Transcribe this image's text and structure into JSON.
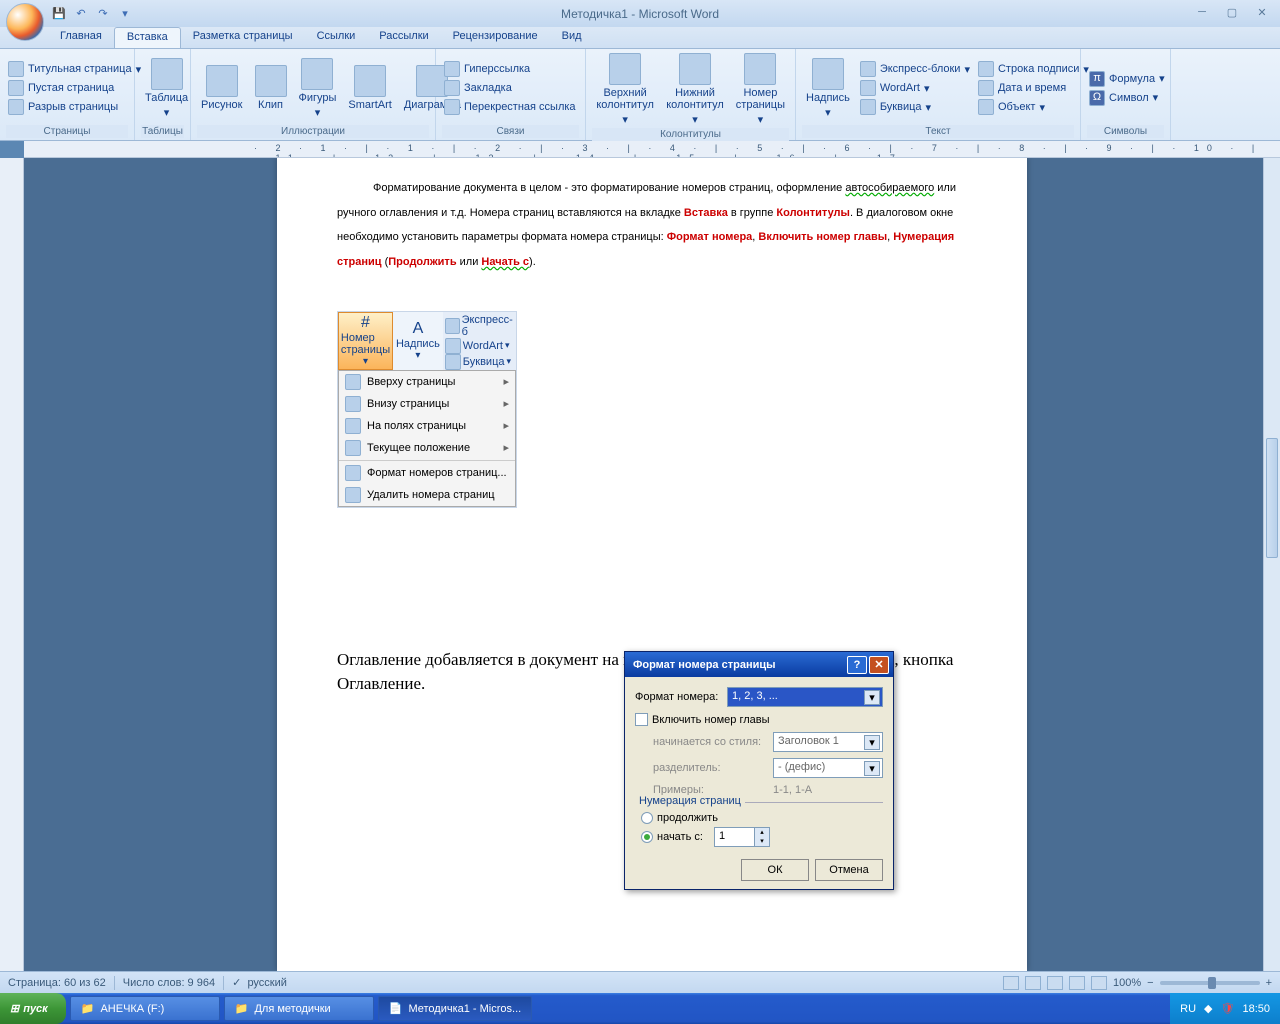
{
  "window": {
    "title": "Методичка1 - Microsoft Word"
  },
  "tabs": [
    "Главная",
    "Вставка",
    "Разметка страницы",
    "Ссылки",
    "Рассылки",
    "Рецензирование",
    "Вид"
  ],
  "ribbon": {
    "pages": {
      "title": "Страницы",
      "items": [
        "Титульная страница",
        "Пустая страница",
        "Разрыв страницы"
      ]
    },
    "tables": {
      "title": "Таблицы",
      "btn": "Таблица"
    },
    "illus": {
      "title": "Иллюстрации",
      "items": [
        "Рисунок",
        "Клип",
        "Фигуры",
        "SmartArt",
        "Диаграмма"
      ]
    },
    "links": {
      "title": "Связи",
      "items": [
        "Гиперссылка",
        "Закладка",
        "Перекрестная ссылка"
      ]
    },
    "headers": {
      "title": "Колонтитулы",
      "items": [
        "Верхний колонтитул",
        "Нижний колонтитул",
        "Номер страницы"
      ]
    },
    "text": {
      "title": "Текст",
      "big": "Надпись",
      "items": [
        "Экспресс-блоки",
        "WordArt",
        "Буквица",
        "Строка подписи",
        "Дата и время",
        "Объект"
      ]
    },
    "symbols": {
      "title": "Символы",
      "items": [
        "Формула",
        "Символ"
      ]
    }
  },
  "document": {
    "p1_pre": "Форматирование документа в целом - это форматирование номеров страниц, оформление ",
    "p1_auto": "автособираемого",
    "p1_mid": " или ручного оглавления и т.д. Номера страниц вставляются на вкладке ",
    "p1_vst": "Вставка",
    "p1_mid2": " в группе ",
    "p1_kol": "Колонтитулы",
    "p1_mid3": ". В диалоговом окне необходимо установить параметры формата номера страницы: ",
    "p1_fn": "Формат номера",
    "p1_c1": ", ",
    "p1_inc": "Включить номер главы",
    "p1_c2": ", ",
    "p1_num": "Нумерация страниц",
    "p1_open": " (",
    "p1_cont": "Продолжить",
    "p1_or": " или ",
    "p1_start": "Начать с",
    "p1_close": ").",
    "toc": "Оглавление добавляется в документ на вкладке Ссылки в группе Оглавление, кнопка Оглавление."
  },
  "embedded": {
    "page_num": "Номер страницы",
    "caption": "Надпись",
    "express": "Экспресс-б",
    "wordart": "WordArt",
    "dropcap": "Буквица",
    "menu": [
      "Вверху страницы",
      "Внизу страницы",
      "На полях страницы",
      "Текущее положение",
      "Формат номеров страниц...",
      "Удалить номера страниц"
    ]
  },
  "dialog": {
    "title": "Формат номера страницы",
    "format_label": "Формат номера:",
    "format_value": "1, 2, 3, ...",
    "include": "Включить номер главы",
    "starts_label": "начинается со стиля:",
    "starts_value": "Заголовок 1",
    "sep_label": "разделитель:",
    "sep_value": "-   (дефис)",
    "examples_label": "Примеры:",
    "examples_value": "1-1, 1-A",
    "numbering": "Нумерация страниц",
    "continue": "продолжить",
    "startat": "начать с:",
    "startat_value": "1",
    "ok": "ОК",
    "cancel": "Отмена"
  },
  "status": {
    "page": "Страница: 60 из 62",
    "words": "Число слов: 9 964",
    "lang": "русский",
    "zoom": "100%",
    "keyboard": "RU"
  },
  "taskbar": {
    "start": "пуск",
    "items": [
      "АНЕЧКА (F:)",
      "Для методички",
      "Методичка1 - Micros..."
    ],
    "time": "18:50"
  }
}
